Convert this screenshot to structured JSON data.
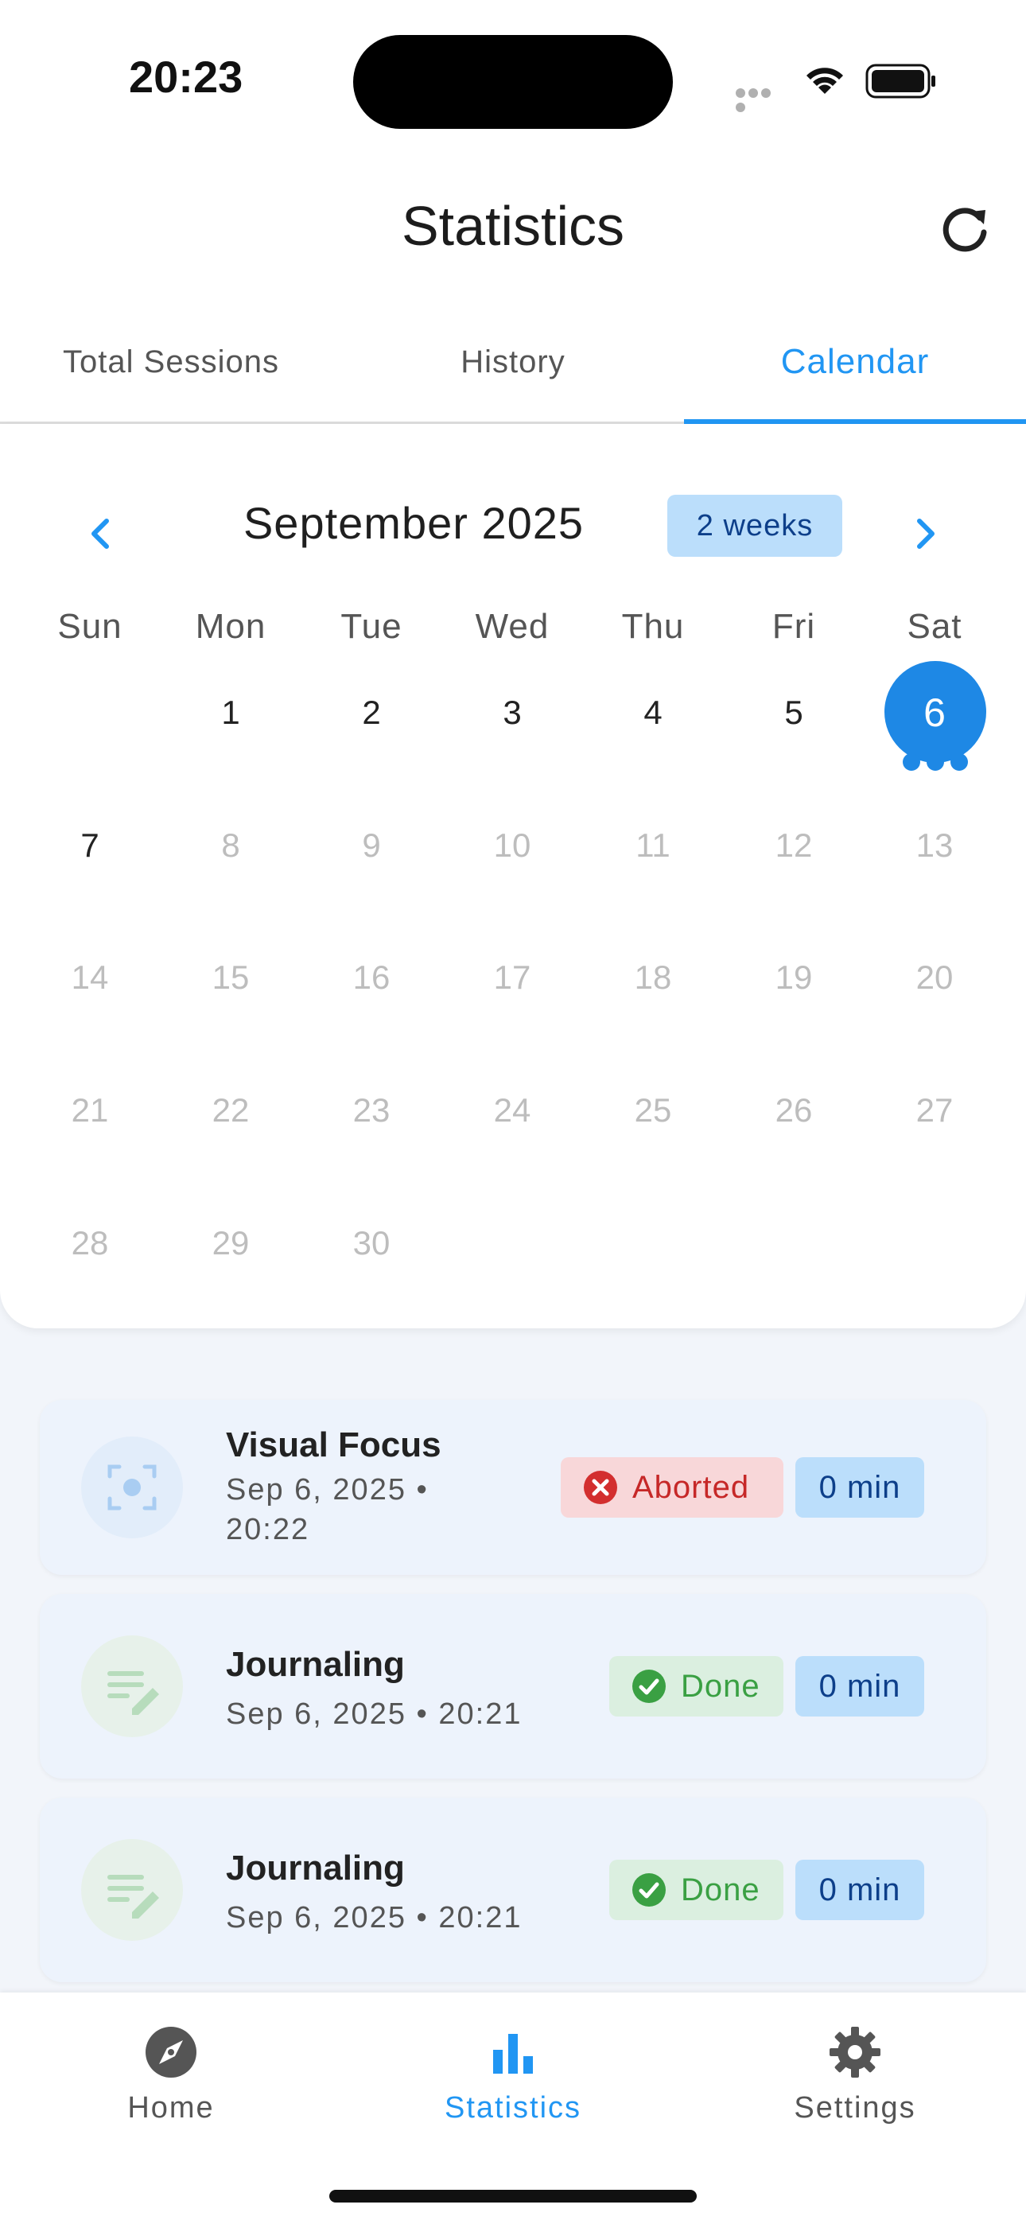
{
  "status_bar": {
    "time": "20:23"
  },
  "header": {
    "title": "Statistics"
  },
  "tabs": [
    {
      "label": "Total Sessions"
    },
    {
      "label": "History"
    },
    {
      "label": "Calendar",
      "active": true
    }
  ],
  "calendar": {
    "month_label": "September 2025",
    "format_button": "2 weeks",
    "weekdays": [
      "Sun",
      "Mon",
      "Tue",
      "Wed",
      "Thu",
      "Fri",
      "Sat"
    ],
    "days": {
      "d1": "1",
      "d2": "2",
      "d3": "3",
      "d4": "4",
      "d5": "5",
      "d6": "6",
      "d7": "7",
      "d8": "8",
      "d9": "9",
      "d10": "10",
      "d11": "11",
      "d12": "12",
      "d13": "13",
      "d14": "14",
      "d15": "15",
      "d16": "16",
      "d17": "17",
      "d18": "18",
      "d19": "19",
      "d20": "20",
      "d21": "21",
      "d22": "22",
      "d23": "23",
      "d24": "24",
      "d25": "25",
      "d26": "26",
      "d27": "27",
      "d28": "28",
      "d29": "29",
      "d30": "30"
    },
    "selected_day": "6",
    "event_marker_count": 3,
    "accent_color": "#1e88e5"
  },
  "sessions": [
    {
      "title": "Visual Focus",
      "meta": "Sep 6, 2025 •\n20:22",
      "status": "Aborted",
      "duration": "0 min",
      "icon": "focus-frame-icon"
    },
    {
      "title": "Journaling",
      "meta": "Sep 6, 2025 • 20:21",
      "status": "Done",
      "duration": "0 min",
      "icon": "notes-edit-icon"
    },
    {
      "title": "Journaling",
      "meta": "Sep 6, 2025 • 20:21",
      "status": "Done",
      "duration": "0 min",
      "icon": "notes-edit-icon"
    }
  ],
  "bottom_nav": [
    {
      "label": "Home",
      "icon": "compass-icon"
    },
    {
      "label": "Statistics",
      "icon": "bar-chart-icon",
      "active": true
    },
    {
      "label": "Settings",
      "icon": "gear-icon"
    }
  ],
  "colors": {
    "primary": "#2196f3",
    "aborted": "#c62828",
    "done": "#3aa043",
    "chip_blue": "#bbdefb"
  }
}
